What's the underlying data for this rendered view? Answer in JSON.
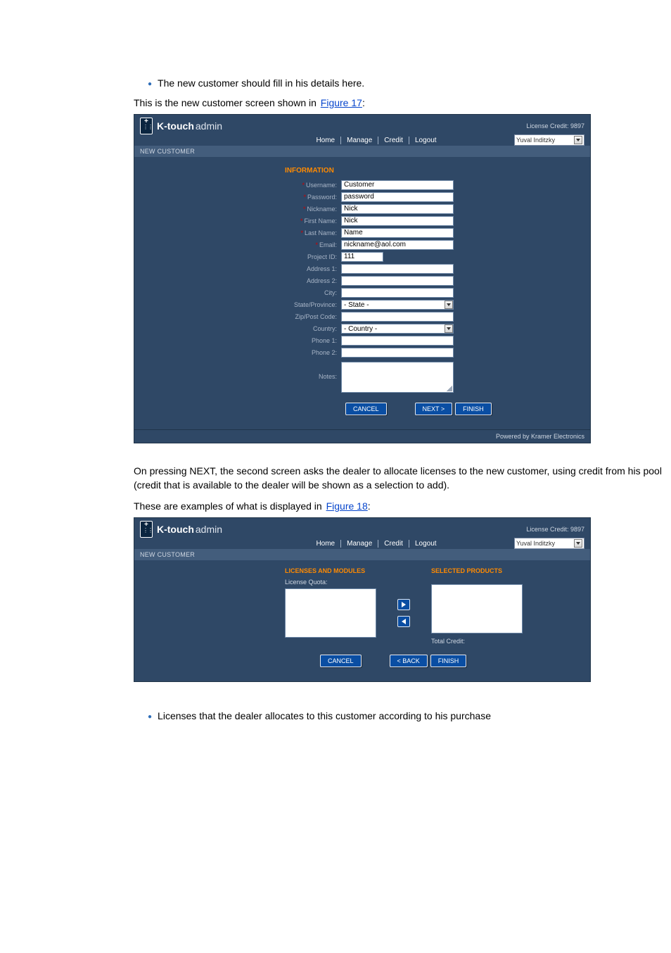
{
  "bullet1": "The new customer should fill in his details here.",
  "bullet2": "Licenses that the dealer allocates to this customer according to his purchase",
  "caption_intro": "This is the new customer screen shown in ",
  "caption1_text": "Figure 17",
  "caption2_text": "Figure 18",
  "next_para": "On pressing NEXT, the second screen asks the dealer to allocate licenses to the new customer, using credit from his pool (credit that is available to the dealer will be shown as a selection to add).",
  "legend_prefix": "These are examples of what is displayed in ",
  "panel1": {
    "license_credit_label": "License Credit:",
    "license_credit_value": "9897",
    "brand_bold": "K-touch",
    "brand_light": "admin",
    "nav": [
      "Home",
      "Manage",
      "Credit",
      "Logout"
    ],
    "user_dropdown": "Yuval Inditzky",
    "breadcrumb": "NEW CUSTOMER",
    "section_title": "INFORMATION",
    "fields": {
      "username_lbl": "Username:",
      "username_val": "Customer",
      "password_lbl": "Password:",
      "password_val": "password",
      "nickname_lbl": "Nickname:",
      "nickname_val": "Nick",
      "firstname_lbl": "First Name:",
      "firstname_val": "Nick",
      "lastname_lbl": "Last Name:",
      "lastname_val": "Name",
      "email_lbl": "Email:",
      "email_val": "nickname@aol.com",
      "projectid_lbl": "Project ID:",
      "projectid_val": "111",
      "addr1_lbl": "Address 1:",
      "addr2_lbl": "Address 2:",
      "city_lbl": "City:",
      "state_lbl": "State/Province:",
      "state_val": "- State -",
      "zip_lbl": "Zip/Post Code:",
      "country_lbl": "Country:",
      "country_val": "- Country -",
      "phone1_lbl": "Phone 1:",
      "phone2_lbl": "Phone 2:",
      "notes_lbl": "Notes:"
    },
    "btn_cancel": "CANCEL",
    "btn_next": "NEXT >",
    "btn_finish": "FINISH",
    "footer": "Powered by Kramer Electronics"
  },
  "panel2": {
    "license_credit_label": "License Credit:",
    "license_credit_value": "9897",
    "brand_bold": "K-touch",
    "brand_light": "admin",
    "nav": [
      "Home",
      "Manage",
      "Credit",
      "Logout"
    ],
    "user_dropdown": "Yuval Inditzky",
    "breadcrumb": "NEW CUSTOMER",
    "col1_title": "LICENSES AND MODULES",
    "col2_title": "SELECTED PRODUCTS",
    "license_quota": "License Quota:",
    "total_credit": "Total Credit:",
    "btn_cancel": "CANCEL",
    "btn_back": "< BACK",
    "btn_finish": "FINISH"
  }
}
